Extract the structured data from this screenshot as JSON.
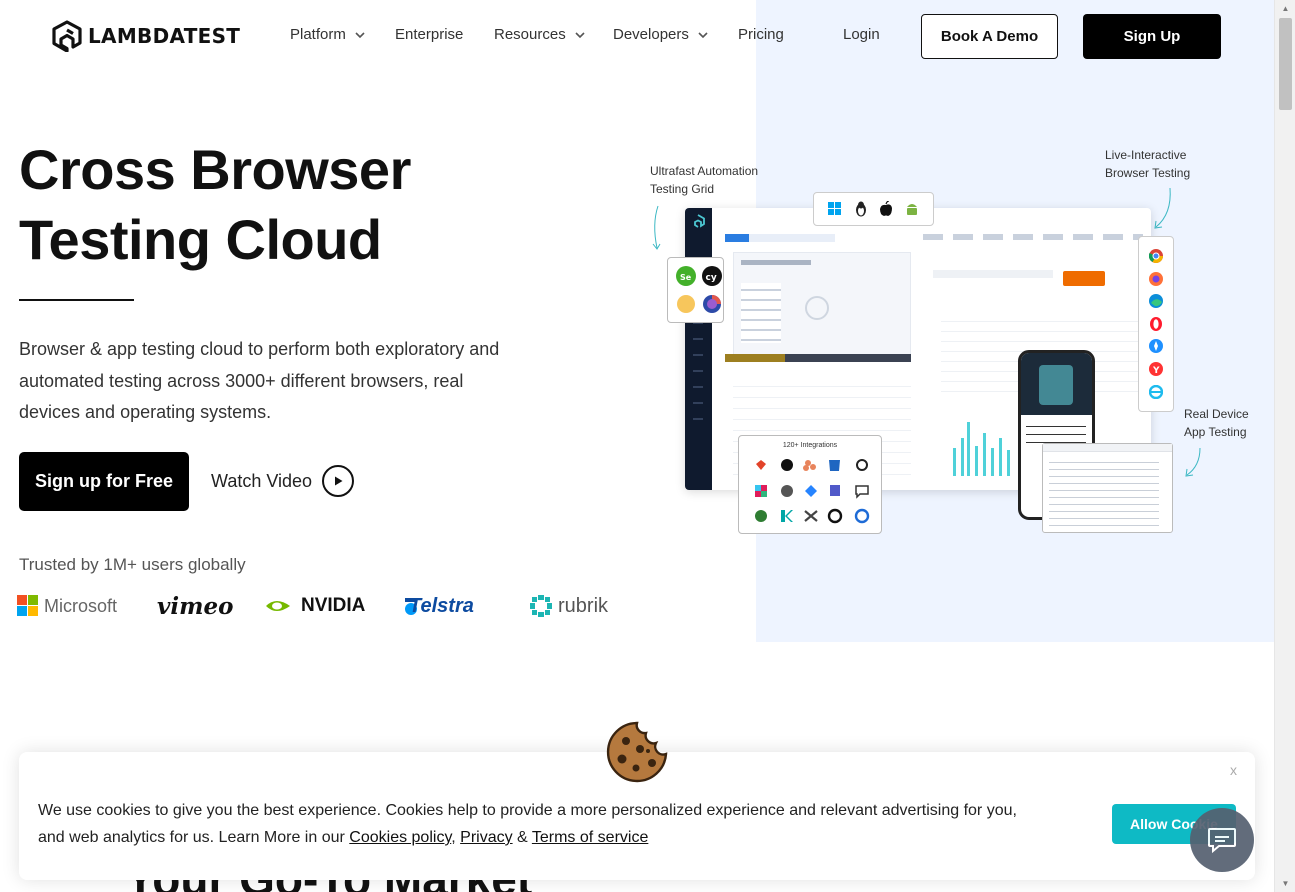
{
  "nav": {
    "brand": "LAMBDATEST",
    "items": [
      {
        "label": "Platform",
        "has_dropdown": true
      },
      {
        "label": "Enterprise",
        "has_dropdown": false
      },
      {
        "label": "Resources",
        "has_dropdown": true
      },
      {
        "label": "Developers",
        "has_dropdown": true
      },
      {
        "label": "Pricing",
        "has_dropdown": false
      }
    ],
    "login": "Login",
    "book_demo": "Book A Demo",
    "sign_up": "Sign Up"
  },
  "hero": {
    "title_line1": "Cross Browser",
    "title_line2": "Testing Cloud",
    "description": "Browser & app testing cloud to perform both exploratory and automated testing across 3000+ different browsers, real devices and operating systems.",
    "cta_primary": "Sign up for Free",
    "cta_secondary": "Watch Video",
    "trusted": "Trusted by 1M+ users globally",
    "brands": [
      "Microsoft",
      "vimeo",
      "NVIDIA",
      "Telstra",
      "rubrik"
    ]
  },
  "illustration": {
    "label_automation_line1": "Ultrafast Automation",
    "label_automation_line2": "Testing Grid",
    "label_live_line1": "Live-Interactive",
    "label_live_line2": "Browser Testing",
    "label_device_line1": "Real Device",
    "label_device_line2": "App Testing",
    "integrations_title": "120+ Integrations"
  },
  "cookie": {
    "text_part1": "We use cookies to give you the best experience. Cookies help to provide a more personalized experience and relevant advertising for you, and web analytics for us. Learn More in our ",
    "cookies_policy": "Cookies policy",
    "sep1": ", ",
    "privacy": "Privacy",
    "sep2": " & ",
    "terms": "Terms of service",
    "allow": "Allow Cookie",
    "close": "x"
  },
  "behind_heading": "Your Go-To Market",
  "colors": {
    "accent_teal": "#0ebac5",
    "hero_bg": "#eef4ff",
    "black": "#000000"
  }
}
